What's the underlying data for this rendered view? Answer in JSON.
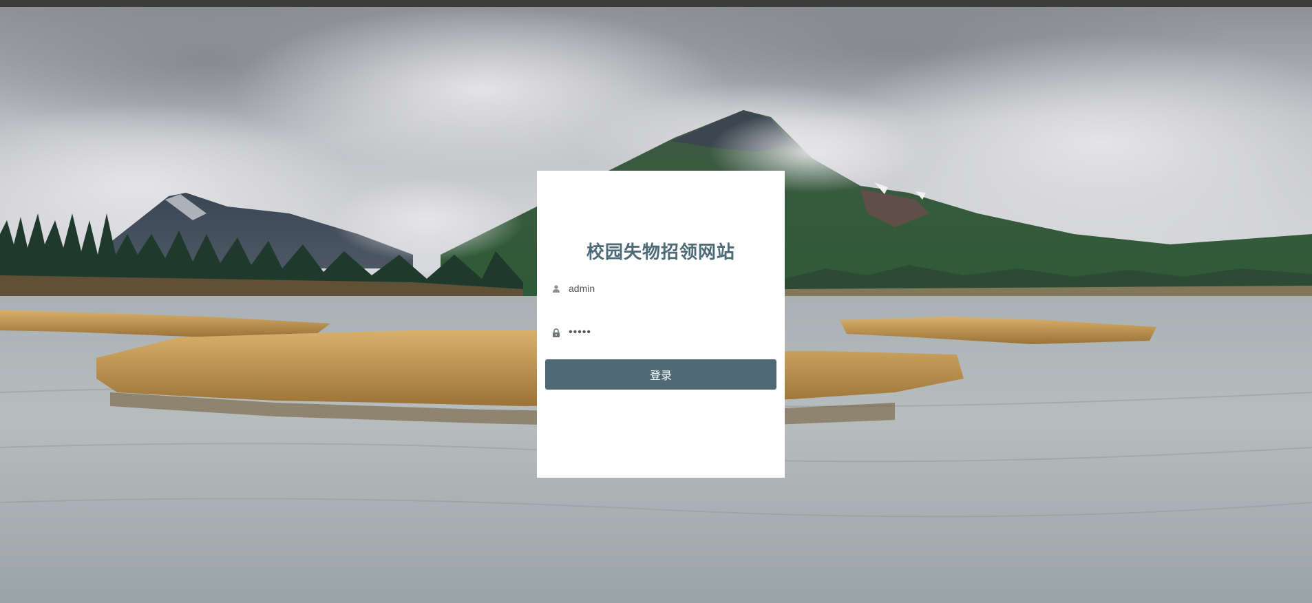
{
  "page": {
    "title": "校园失物招领网站"
  },
  "login": {
    "username_value": "admin",
    "password_value": "•••••",
    "submit_label": "登录"
  },
  "icons": {
    "username": "user-icon",
    "password": "lock-icon"
  },
  "colors": {
    "title": "#4d6a77",
    "button": "#4f6a75",
    "card": "#ffffff",
    "topbar": "#3c3c3c"
  }
}
